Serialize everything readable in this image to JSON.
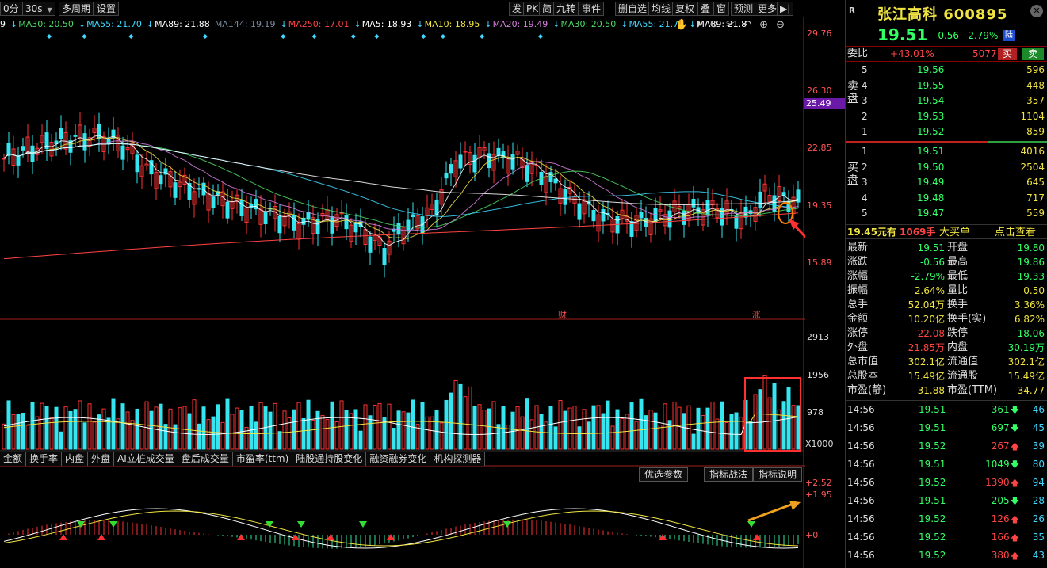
{
  "toolbar": {
    "period": "0分",
    "freq": "30s",
    "multi_period": "多周期",
    "settings": "设置",
    "right_buttons": [
      "发",
      "PK",
      "简",
      "九转",
      "事件",
      "删自选",
      "均线",
      "复权",
      "叠",
      "窗",
      "预测",
      "更多"
    ]
  },
  "ma_legend": [
    {
      "label": "9",
      "color": "#ffffff",
      "arrow": false
    },
    {
      "label": "MA30: 20.50",
      "color": "#4cd964",
      "arrow": true
    },
    {
      "label": "MA55: 21.70",
      "color": "#3fd9ff",
      "arrow": true
    },
    {
      "label": "MA89: 21.88",
      "color": "#ffffff",
      "arrow": true
    },
    {
      "label": "MA144: 19.19",
      "color": "#7a8aa0",
      "arrow": false
    },
    {
      "label": "MA250: 17.01",
      "color": "#ff4444",
      "arrow": true
    },
    {
      "label": "MA5: 18.93",
      "color": "#ffffff",
      "arrow": true
    },
    {
      "label": "MA10: 18.95",
      "color": "#f0e442",
      "arrow": true
    },
    {
      "label": "MA20: 19.49",
      "color": "#d77fe0",
      "arrow": true
    },
    {
      "label": "MA30: 20.50",
      "color": "#4cd964",
      "arrow": true
    },
    {
      "label": "MA55: 21.70",
      "color": "#3fd9ff",
      "arrow": true
    },
    {
      "label": "MA89: 21.8",
      "color": "#ffffff",
      "arrow": true
    }
  ],
  "price_axis": {
    "labels": [
      "29.76",
      "26.30",
      "22.85",
      "19.35",
      "15.89"
    ],
    "highlight": "25.49"
  },
  "volume_axis": {
    "labels": [
      "2913",
      "1956",
      "978"
    ],
    "unit": "X1000"
  },
  "macd_axis": {
    "labels": [
      "+2.52",
      "+1.95",
      "+0"
    ]
  },
  "event_markers": [
    "财",
    "涨"
  ],
  "indicator_tabs": [
    "金额",
    "换手率",
    "内盘",
    "外盘",
    "AI立桩成交量",
    "盘后成交量",
    "市盈率(ttm)",
    "陆股通持股变化",
    "融资融券变化",
    "机构探测器"
  ],
  "indicator_buttons": [
    "优选参数",
    "指标战法",
    "指标说明"
  ],
  "panel": {
    "badge": "R",
    "name": "张江高科 600895",
    "price": "19.51",
    "change": "-0.56",
    "change_pct": "-2.79%",
    "exchange_badge": "陆",
    "weibi_label": "委比",
    "weibi_value": "+43.01%",
    "weicha": "5077",
    "sell_btn": "买",
    "buy_btn": "卖",
    "sell_side_label": "卖盘",
    "buy_side_label": "买盘",
    "asks": [
      {
        "level": "5",
        "price": "19.56",
        "vol": "596"
      },
      {
        "level": "4",
        "price": "19.55",
        "vol": "448"
      },
      {
        "level": "3",
        "price": "19.54",
        "vol": "357"
      },
      {
        "level": "2",
        "price": "19.53",
        "vol": "1104"
      },
      {
        "level": "1",
        "price": "19.52",
        "vol": "859"
      }
    ],
    "bids": [
      {
        "level": "1",
        "price": "19.51",
        "vol": "4016"
      },
      {
        "level": "2",
        "price": "19.50",
        "vol": "2504"
      },
      {
        "level": "3",
        "price": "19.49",
        "vol": "645"
      },
      {
        "level": "4",
        "price": "19.48",
        "vol": "717"
      },
      {
        "level": "5",
        "price": "19.47",
        "vol": "559"
      }
    ],
    "big_order": {
      "price": "19.45元有",
      "vol": "1069手",
      "label": "大买单",
      "link": "点击查看"
    },
    "quote": [
      {
        "l1": "最新",
        "v1": "19.51",
        "c1": "g",
        "l2": "开盘",
        "v2": "19.80",
        "c2": "g"
      },
      {
        "l1": "涨跌",
        "v1": "-0.56",
        "c1": "g",
        "l2": "最高",
        "v2": "19.86",
        "c2": "g"
      },
      {
        "l1": "涨幅",
        "v1": "-2.79%",
        "c1": "g",
        "l2": "最低",
        "v2": "19.33",
        "c2": "g"
      },
      {
        "l1": "振幅",
        "v1": "2.64%",
        "c1": "y",
        "l2": "量比",
        "v2": "0.50",
        "c2": "y"
      },
      {
        "l1": "总手",
        "v1": "52.04万",
        "c1": "y",
        "l2": "换手",
        "v2": "3.36%",
        "c2": "y"
      },
      {
        "l1": "金额",
        "v1": "10.20亿",
        "c1": "y",
        "l2": "换手(实)",
        "v2": "6.82%",
        "c2": "y"
      },
      {
        "l1": "涨停",
        "v1": "22.08",
        "c1": "r",
        "l2": "跌停",
        "v2": "18.06",
        "c2": "g"
      },
      {
        "l1": "外盘",
        "v1": "21.85万",
        "c1": "r",
        "l2": "内盘",
        "v2": "30.19万",
        "c2": "g"
      },
      {
        "l1": "总市值",
        "v1": "302.1亿",
        "c1": "y",
        "l2": "流通值",
        "v2": "302.1亿",
        "c2": "y"
      },
      {
        "l1": "总股本",
        "v1": "15.49亿",
        "c1": "y",
        "l2": "流通股",
        "v2": "15.49亿",
        "c2": "y"
      },
      {
        "l1": "市盈(静)",
        "v1": "31.88",
        "c1": "y",
        "l2": "市盈(TTM)",
        "v2": "34.77",
        "c2": "y"
      }
    ],
    "ticks": [
      {
        "time": "14:56",
        "price": "19.51",
        "vol": "361",
        "dir": "dn",
        "n": "46"
      },
      {
        "time": "14:56",
        "price": "19.51",
        "vol": "697",
        "dir": "dn",
        "n": "45"
      },
      {
        "time": "14:56",
        "price": "19.52",
        "vol": "267",
        "dir": "up",
        "n": "39"
      },
      {
        "time": "14:56",
        "price": "19.51",
        "vol": "1049",
        "dir": "dn",
        "n": "80"
      },
      {
        "time": "14:56",
        "price": "19.52",
        "vol": "1390",
        "dir": "up",
        "n": "94"
      },
      {
        "time": "14:56",
        "price": "19.51",
        "vol": "205",
        "dir": "dn",
        "n": "28"
      },
      {
        "time": "14:56",
        "price": "19.52",
        "vol": "126",
        "dir": "up",
        "n": "26"
      },
      {
        "time": "14:56",
        "price": "19.52",
        "vol": "166",
        "dir": "up",
        "n": "35"
      },
      {
        "time": "14:56",
        "price": "19.52",
        "vol": "380",
        "dir": "up",
        "n": "43"
      }
    ]
  },
  "colors": {
    "up": "#ff3333",
    "down": "#35e6f0",
    "ma5": "#ffffff",
    "ma10": "#f0e442",
    "ma20": "#d77fe0",
    "ma30": "#4cd964",
    "ma55": "#3fd9ff",
    "ma89": "#ffffff",
    "ma250": "#ff4444",
    "annotation": "#ff7f00"
  }
}
